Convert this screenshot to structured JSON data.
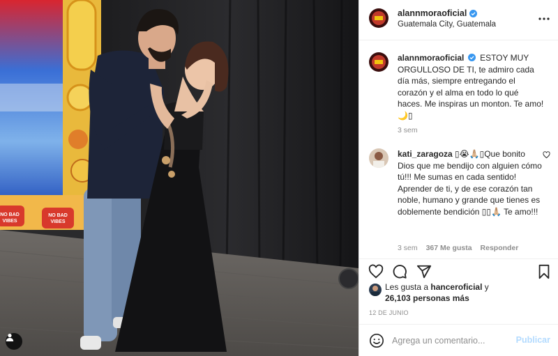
{
  "post": {
    "username": "alannmoraoficial",
    "location": "Guatemala City, Guatemala",
    "verified": true,
    "more_icon": "more-horizontal-icon"
  },
  "photo": {
    "sign_texts": [
      "NO BAD VIBES",
      "NO BAD VIBES"
    ],
    "user_tag_icon": "user-icon"
  },
  "caption": {
    "username": "alannmoraoficial",
    "text": "ESTOY MUY ORGULLOSO DE TI, te admiro cada día más, siempre entregando el corazón y el alma en todo lo qué haces. Me inspiras un monton. Te amo! 🌙▯",
    "time": "3 sem"
  },
  "comments": [
    {
      "username": "kati_zaragoza",
      "text": "▯😭🙏🏼▯Que bonito Dios que me bendijo con alguien cómo tú!!! Me sumas en cada sentido! Aprender de ti, y de ese corazón tan noble, humano y grande que tienes es doblemente bendición ▯▯🙏🏼 Te amo!!!",
      "time": "3 sem",
      "likes": "367 Me gusta",
      "reply": "Responder"
    }
  ],
  "actions": {
    "like_icon": "heart-icon",
    "comment_icon": "comment-icon",
    "share_icon": "share-icon",
    "save_icon": "bookmark-icon"
  },
  "likes": {
    "prefix": "Les gusta a",
    "user": "hanceroficial",
    "conj": "y",
    "others": "26,103 personas más"
  },
  "date": "12 DE JUNIO",
  "add_comment": {
    "emoji_icon": "emoji-icon",
    "placeholder": "Agrega un comentario...",
    "publish": "Publicar"
  },
  "colors": {
    "verified": "#3897f0",
    "publish_disabled": "#b3dbff",
    "meta": "#8e8e8e",
    "text": "#262626"
  }
}
